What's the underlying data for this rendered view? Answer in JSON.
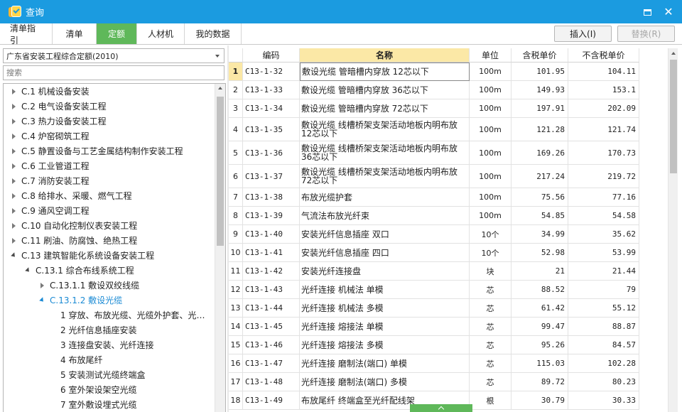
{
  "window": {
    "title": "查询"
  },
  "tabs": [
    {
      "label": "清单指引"
    },
    {
      "label": "清单"
    },
    {
      "label": "定额"
    },
    {
      "label": "人材机"
    },
    {
      "label": "我的数据"
    }
  ],
  "actions": {
    "insert": "插入(I)",
    "replace": "替换(R)"
  },
  "library": {
    "selected": "广东省安装工程综合定额(2010)"
  },
  "search": {
    "placeholder": "搜索"
  },
  "tree": [
    {
      "label": "C.1 机械设备安装",
      "state": "closed"
    },
    {
      "label": "C.2 电气设备安装工程",
      "state": "closed"
    },
    {
      "label": "C.3 热力设备安装工程",
      "state": "closed"
    },
    {
      "label": "C.4 炉窑砌筑工程",
      "state": "closed"
    },
    {
      "label": "C.5 静置设备与工艺金属结构制作安装工程",
      "state": "closed"
    },
    {
      "label": "C.6 工业管道工程",
      "state": "closed"
    },
    {
      "label": "C.7 消防安装工程",
      "state": "closed"
    },
    {
      "label": "C.8 给排水、采暖、燃气工程",
      "state": "closed"
    },
    {
      "label": "C.9 通风空调工程",
      "state": "closed"
    },
    {
      "label": "C.10 自动化控制仪表安装工程",
      "state": "closed"
    },
    {
      "label": "C.11 刷油、防腐蚀、绝热工程",
      "state": "closed"
    },
    {
      "label": "C.13 建筑智能化系统设备安装工程",
      "state": "open"
    },
    {
      "label": "C.13.1 综合布线系统工程",
      "state": "open"
    },
    {
      "label": "C.13.1.1 敷设双绞线缆",
      "state": "closed"
    },
    {
      "label": "C.13.1.2 敷设光缆",
      "state": "open",
      "selected": true
    },
    {
      "label": "1 穿放、布放光缆、光缆外护套、光…",
      "state": "leaf"
    },
    {
      "label": "2 光纤信息插座安装",
      "state": "leaf"
    },
    {
      "label": "3 连接盘安装、光纤连接",
      "state": "leaf"
    },
    {
      "label": "4 布放尾纤",
      "state": "leaf"
    },
    {
      "label": "5 安装测试光缆终端盒",
      "state": "leaf"
    },
    {
      "label": "6 室外架设架空光缆",
      "state": "leaf"
    },
    {
      "label": "7 室外敷设埋式光缆",
      "state": "leaf"
    }
  ],
  "table": {
    "columns": [
      "编码",
      "名称",
      "单位",
      "含税单价",
      "不含税单价"
    ],
    "rows": [
      {
        "idx": "1",
        "code": "C13-1-32",
        "name": "敷设光缆 管暗槽内穿放 12芯以下",
        "unit": "100m",
        "taxed": "101.95",
        "untaxed": "104.11"
      },
      {
        "idx": "2",
        "code": "C13-1-33",
        "name": "敷设光缆 管暗槽内穿放 36芯以下",
        "unit": "100m",
        "taxed": "149.93",
        "untaxed": "153.1"
      },
      {
        "idx": "3",
        "code": "C13-1-34",
        "name": "敷设光缆 管暗槽内穿放 72芯以下",
        "unit": "100m",
        "taxed": "197.91",
        "untaxed": "202.09"
      },
      {
        "idx": "4",
        "code": "C13-1-35",
        "name": "敷设光缆 线槽桥架支架活动地板内明布放 12芯以下",
        "unit": "100m",
        "taxed": "121.28",
        "untaxed": "121.74"
      },
      {
        "idx": "5",
        "code": "C13-1-36",
        "name": "敷设光缆 线槽桥架支架活动地板内明布放 36芯以下",
        "unit": "100m",
        "taxed": "169.26",
        "untaxed": "170.73"
      },
      {
        "idx": "6",
        "code": "C13-1-37",
        "name": "敷设光缆 线槽桥架支架活动地板内明布放 72芯以下",
        "unit": "100m",
        "taxed": "217.24",
        "untaxed": "219.72"
      },
      {
        "idx": "7",
        "code": "C13-1-38",
        "name": "布放光缆护套",
        "unit": "100m",
        "taxed": "75.56",
        "untaxed": "77.16"
      },
      {
        "idx": "8",
        "code": "C13-1-39",
        "name": "气流法布放光纤束",
        "unit": "100m",
        "taxed": "54.85",
        "untaxed": "54.58"
      },
      {
        "idx": "9",
        "code": "C13-1-40",
        "name": "安装光纤信息插座 双口",
        "unit": "10个",
        "taxed": "34.99",
        "untaxed": "35.62"
      },
      {
        "idx": "10",
        "code": "C13-1-41",
        "name": "安装光纤信息插座 四口",
        "unit": "10个",
        "taxed": "52.98",
        "untaxed": "53.99"
      },
      {
        "idx": "11",
        "code": "C13-1-42",
        "name": "安装光纤连接盘",
        "unit": "块",
        "taxed": "21",
        "untaxed": "21.44"
      },
      {
        "idx": "12",
        "code": "C13-1-43",
        "name": "光纤连接 机械法 单模",
        "unit": "芯",
        "taxed": "88.52",
        "untaxed": "79"
      },
      {
        "idx": "13",
        "code": "C13-1-44",
        "name": "光纤连接 机械法 多模",
        "unit": "芯",
        "taxed": "61.42",
        "untaxed": "55.12"
      },
      {
        "idx": "14",
        "code": "C13-1-45",
        "name": "光纤连接 熔接法 单模",
        "unit": "芯",
        "taxed": "99.47",
        "untaxed": "88.87"
      },
      {
        "idx": "15",
        "code": "C13-1-46",
        "name": "光纤连接 熔接法 多模",
        "unit": "芯",
        "taxed": "95.26",
        "untaxed": "84.57"
      },
      {
        "idx": "16",
        "code": "C13-1-47",
        "name": "光纤连接 磨制法(端口) 单模",
        "unit": "芯",
        "taxed": "115.03",
        "untaxed": "102.28"
      },
      {
        "idx": "17",
        "code": "C13-1-48",
        "name": "光纤连接 磨制法(端口) 多模",
        "unit": "芯",
        "taxed": "89.72",
        "untaxed": "80.23"
      },
      {
        "idx": "18",
        "code": "C13-1-49",
        "name": "布放尾纤 终端盒至光纤配线架",
        "unit": "根",
        "taxed": "30.79",
        "untaxed": "30.33"
      }
    ]
  },
  "colors": {
    "titlebar": "#1b9be0",
    "active_tab": "#5fb85a",
    "header_highlight": "#fbe8a6",
    "selected_tree": "#1a8ad4"
  },
  "icons": {
    "app": "app-logo-icon",
    "maximize": "maximize-icon",
    "close": "close-icon",
    "dropdown": "chevron-down-icon"
  }
}
